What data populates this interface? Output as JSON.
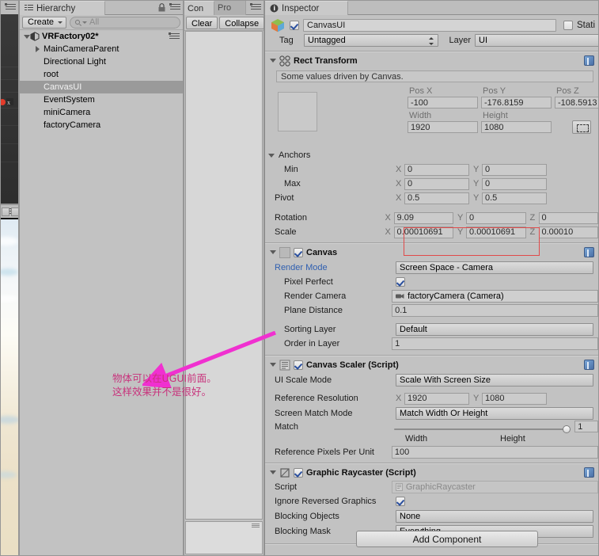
{
  "app": {
    "name": "Unity Editor"
  },
  "scene_view": {
    "tab_label": ""
  },
  "game_view": {
    "tab_label": ""
  },
  "hierarchy": {
    "tab_label": "Hierarchy",
    "create_button": "Create",
    "search_placeholder": "All",
    "scene_name": "VRFactory02*",
    "items": [
      {
        "label": "MainCameraParent",
        "expandable": true,
        "selected": false
      },
      {
        "label": "Directional Light",
        "expandable": false,
        "selected": false
      },
      {
        "label": "root",
        "expandable": false,
        "selected": false
      },
      {
        "label": "CanvasUI",
        "expandable": false,
        "selected": true
      },
      {
        "label": "EventSystem",
        "expandable": false,
        "selected": false
      },
      {
        "label": "miniCamera",
        "expandable": false,
        "selected": false
      },
      {
        "label": "factoryCamera",
        "expandable": false,
        "selected": false
      }
    ]
  },
  "console": {
    "tab_label": "Con",
    "project_tab_label": "Pro",
    "clear_button": "Clear",
    "collapse_button": "Collapse"
  },
  "inspector": {
    "tab_label": "Inspector",
    "object_name": "CanvasUI",
    "static_label": "Stati",
    "tag_label": "Tag",
    "tag_value": "Untagged",
    "layer_label": "Layer",
    "layer_value": "UI",
    "rect_transform": {
      "title": "Rect Transform",
      "help_text": "Some values driven by Canvas.",
      "pos_x_label": "Pos X",
      "pos_y_label": "Pos Y",
      "pos_z_label": "Pos Z",
      "pos_x": "-100",
      "pos_y": "-176.8159",
      "pos_z": "-108.5913",
      "width_label": "Width",
      "height_label": "Height",
      "width": "1920",
      "height": "1080",
      "anchors_label": "Anchors",
      "min_label": "Min",
      "max_label": "Max",
      "pivot_label": "Pivot",
      "min_x": "0",
      "min_y": "0",
      "max_x": "0",
      "max_y": "0",
      "pivot_x": "0.5",
      "pivot_y": "0.5",
      "rotation_label": "Rotation",
      "rot_x": "9.09",
      "rot_y": "0",
      "rot_z": "0",
      "scale_label": "Scale",
      "scale_x": "0.00010691",
      "scale_y": "0.00010691",
      "scale_z": "0.00010",
      "axis_x": "X",
      "axis_y": "Y",
      "axis_z": "Z"
    },
    "canvas": {
      "title": "Canvas",
      "render_mode_label": "Render Mode",
      "render_mode_value": "Screen Space - Camera",
      "pixel_perfect_label": "Pixel Perfect",
      "pixel_perfect_checked": true,
      "render_camera_label": "Render Camera",
      "render_camera_value": "factoryCamera (Camera)",
      "plane_distance_label": "Plane Distance",
      "plane_distance_value": "0.1",
      "sorting_layer_label": "Sorting Layer",
      "sorting_layer_value": "Default",
      "order_in_layer_label": "Order in Layer",
      "order_in_layer_value": "1"
    },
    "canvas_scaler": {
      "title": "Canvas Scaler (Script)",
      "ui_scale_mode_label": "UI Scale Mode",
      "ui_scale_mode_value": "Scale With Screen Size",
      "reference_resolution_label": "Reference Resolution",
      "ref_res_x": "1920",
      "ref_res_y": "1080",
      "screen_match_mode_label": "Screen Match Mode",
      "screen_match_mode_value": "Match Width Or Height",
      "match_label": "Match",
      "match_value": "1",
      "match_left_label": "Width",
      "match_right_label": "Height",
      "ref_ppu_label": "Reference Pixels Per Unit",
      "ref_ppu_value": "100",
      "axis_x": "X",
      "axis_y": "Y"
    },
    "graphic_raycaster": {
      "title": "Graphic Raycaster (Script)",
      "script_label": "Script",
      "script_value": "GraphicRaycaster",
      "ignore_reversed_label": "Ignore Reversed Graphics",
      "ignore_reversed_checked": true,
      "blocking_objects_label": "Blocking Objects",
      "blocking_objects_value": "None",
      "blocking_mask_label": "Blocking Mask",
      "blocking_mask_value": "Everything"
    },
    "add_component_button": "Add Component"
  },
  "annotation": {
    "line1": "物体可以在UGUI前面。",
    "line2": "这样效果并不是很好。",
    "color": "#c8337c"
  },
  "colors": {
    "panel_bg": "#c2c2c2",
    "selection": "#9a9a9a",
    "link": "#2f5fb0",
    "highlight_box": "#e04a4a",
    "annotation": "#c8337c"
  }
}
